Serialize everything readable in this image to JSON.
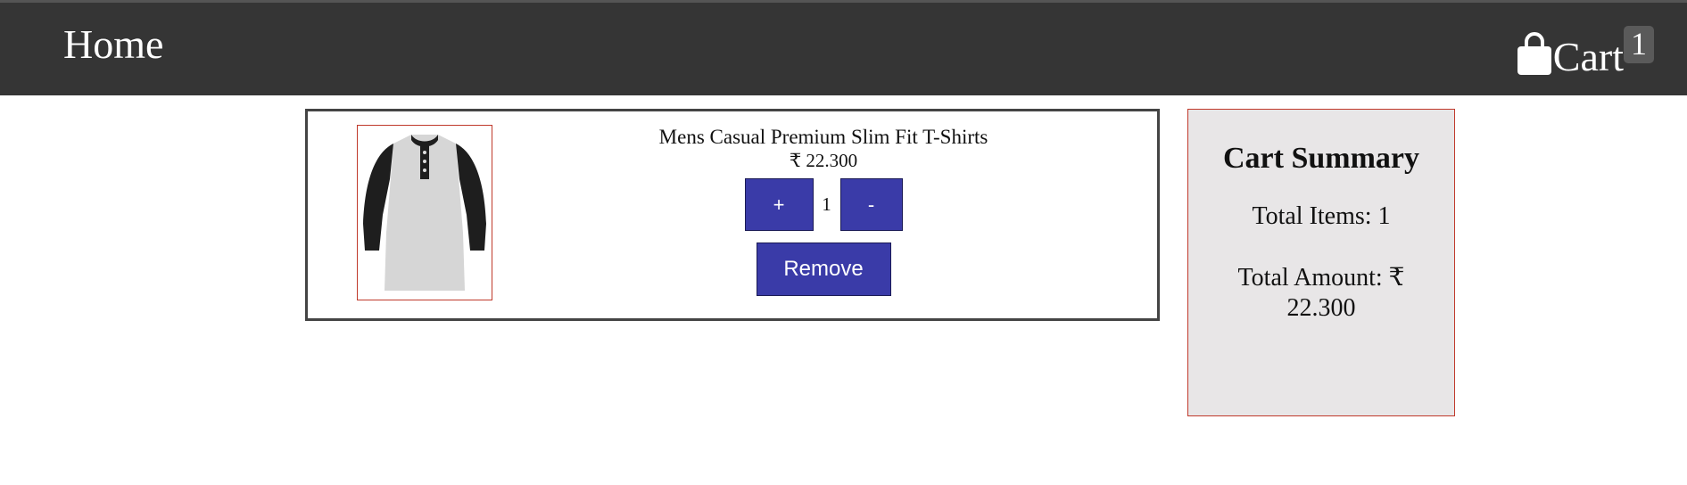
{
  "nav": {
    "home_label": "Home",
    "cart_label": "Cart",
    "cart_count": "1",
    "cart_icon": "shopping-bag-icon"
  },
  "cart_items": [
    {
      "title": "Mens Casual Premium Slim Fit T-Shirts",
      "price": "₹ 22.300",
      "quantity": "1",
      "plus_label": "+",
      "minus_label": "-",
      "remove_label": "Remove",
      "image_icon": "henley-shirt-image"
    }
  ],
  "summary": {
    "title": "Cart Summary",
    "total_items": "Total Items: 1",
    "total_amount": "Total Amount: ₹ 22.300"
  },
  "colors": {
    "navbar": "#353535",
    "button": "#3a3ba8",
    "summary_bg": "#e8e6e7",
    "accent_border": "#c0392b"
  }
}
